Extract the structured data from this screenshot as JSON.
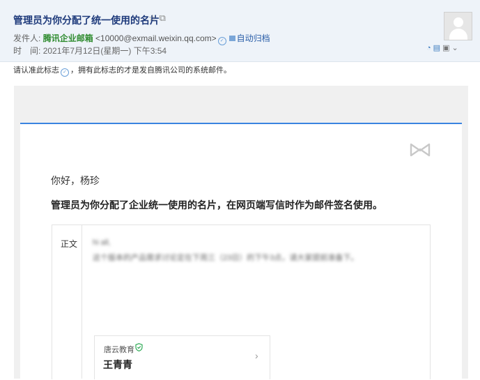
{
  "email": {
    "subject": "管理员为你分配了统一使用的名片",
    "from_label": "发件人:",
    "sender_name": "腾讯企业邮箱",
    "sender_address": "<10000@exmail.weixin.qq.com>",
    "archive_label": "自动归档",
    "time_label": "时　间:",
    "time_value": "2021年7月12日(星期一) 下午3:54"
  },
  "notice": {
    "prefix": "请认准此标志",
    "suffix": "，拥有此标志的才是发自腾讯公司的系统邮件。"
  },
  "body": {
    "greeting": "你好，杨珍",
    "headline": "管理员为你分配了企业统一使用的名片，在网页端写信时作为邮件签名使用。",
    "preview_label": "正文",
    "preview_line1": "hi all,",
    "preview_line2": "这个版本的产品需求讨论定在下周三（23日）的下午3点，请大家提前准备下。"
  },
  "namecard": {
    "company": "唐云教育",
    "name": "王青青"
  },
  "icons": {
    "star": "star-icon",
    "popout": "popout-icon",
    "brand": "tencent-exmail-logo-icon",
    "shield": "verified-shield-icon",
    "arrow": "chevron-right-icon"
  },
  "colors": {
    "accent": "#3a84e0",
    "sender": "#2e8b2e",
    "subject": "#1e3a7b",
    "verified": "#2eaa55"
  }
}
